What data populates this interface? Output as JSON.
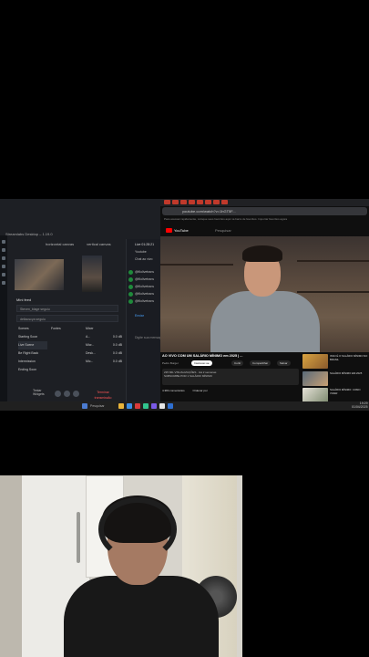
{
  "streamlabs": {
    "window_title": "Streamlabs Desktop – 1.19.0",
    "tabs": [
      "horizontal canvas",
      "vertical canvas"
    ],
    "mini_feed_label": "Mini feed",
    "feed_rows": [
      {
        "name": "Steven_blage",
        "detail": "seguiu"
      },
      {
        "name": "dellaoscya",
        "detail": "seguiu"
      }
    ],
    "section_headers": {
      "scenes": "Scenes",
      "sources": "Fontes",
      "mixer": "Mixer"
    },
    "scenes": [
      "Starting Soon",
      "Live Scene",
      "Be Right Back",
      "Intermission",
      "Ending Soon"
    ],
    "mixer_values": [
      "0.0 dB",
      "0.0 dB",
      "0.0 dB",
      "0.0 dB"
    ],
    "mixer_labels": [
      "A...",
      "Micr...",
      "Desk...",
      "Mic..."
    ],
    "bottom": {
      "left1": "Testar",
      "left2": "Widgets",
      "end_stream_1": "Terminar",
      "end_stream_2": "transmissão"
    }
  },
  "chat": {
    "header": "Live 01:28:21",
    "tab": "Youtube",
    "input_placeholder": "Chat ao vivo",
    "messages": [
      "@filolivetrans",
      "@filolivetrans",
      "@filolivetrans",
      "@filolivetrans",
      "@filolivetrans"
    ],
    "prompt": "Enviar",
    "footer": "Digite sua mensagem..."
  },
  "browser": {
    "url": "youtube.com/watch?v=1hGT5F...",
    "bookmarks": "Para acessar rapidamente, coloque seus favoritos aqui na barra de favoritos. Importar favoritos agora",
    "site": "YouTube",
    "search_placeholder": "Pesquisar",
    "video_title": "AO VIVO COM UM SALÁRIO MÍNIMO em 2025 | ...",
    "channel": "Pedro Burger",
    "subscribe": "Inscrever-se",
    "actions": [
      "Curtir",
      "Compartilhar",
      "Salvar"
    ],
    "desc_line1": "235 MIL VISUALIZAÇÕES · Há 2 semanas",
    "desc_line2": "SUBSCRIBE POR 1 SALÁRIO MÍNIMO",
    "comments_label": "4.384 comentários",
    "sort_label": "Ordenar por",
    "side_items": [
      "ISSO É O SALÁRIO MÍNIMO NO BRASIL",
      "SALÁRIO MÍNIMO EM 2025",
      "SALÁRIO MÍNIMO: COMO VIVER"
    ]
  },
  "taskbar": {
    "search": "Pesquisar",
    "time": "19:29",
    "date": "01/04/2025"
  }
}
